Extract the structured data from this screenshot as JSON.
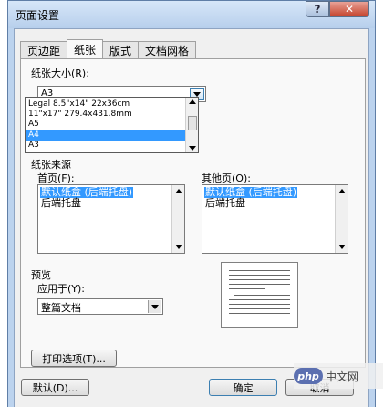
{
  "window": {
    "title": "页面设置"
  },
  "titlebar": {
    "help_glyph": "?",
    "close_glyph": "✕"
  },
  "tabs": [
    {
      "label": "页边距"
    },
    {
      "label": "纸张"
    },
    {
      "label": "版式"
    },
    {
      "label": "文档网格"
    }
  ],
  "paper_size": {
    "label": "纸张大小(R):",
    "selected": "A3",
    "options": [
      "Legal 8.5\"x14\" 22x36cm",
      "11\"x17\" 279.4x431.8mm",
      "A5",
      "A4",
      "A3"
    ],
    "highlighted_index": 3
  },
  "paper_source": {
    "label": "纸张来源",
    "first_page": {
      "label": "首页(F):",
      "items": [
        "默认纸盒 (后端托盘)",
        "后端托盘"
      ]
    },
    "other_pages": {
      "label": "其他页(O):",
      "items": [
        "默认纸盒 (后端托盘)",
        "后端托盘"
      ]
    }
  },
  "preview": {
    "label": "预览",
    "apply_to_label": "应用于(Y):",
    "apply_to_value": "整篇文档"
  },
  "buttons": {
    "print_options": "打印选项(T)...",
    "default": "默认(D)...",
    "ok": "确定",
    "cancel": "取消"
  },
  "watermark": {
    "logo": "php",
    "text": "中文网"
  }
}
